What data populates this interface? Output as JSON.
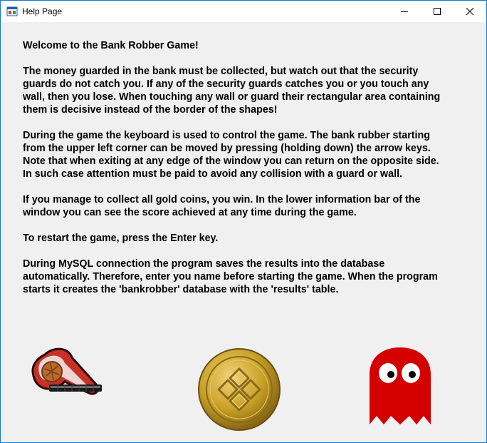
{
  "window": {
    "title": "Help Page",
    "icons": {
      "app": "window-app-icon",
      "minimize": "minimize-icon",
      "maximize": "maximize-icon",
      "close": "close-icon"
    }
  },
  "help": {
    "heading": "Welcome to the Bank Robber Game!",
    "p1": "The money guarded in the bank must be collected, but watch out that the security guards do not catch you. If any of the security guards catches you or you touch any  wall, then you lose. When touching any wall or guard their rectangular area containing them is decisive instead of the border of the shapes!",
    "p2": "During the game the keyboard is used to control the game. The bank rubber starting from the upper left corner can be moved by pressing (holding down) the arrow keys. Note that when exiting at any edge of the window you can return on the opposite side. In such case attention must be paid to avoid any collision with a guard or wall.",
    "p3": "If you manage to collect all gold coins, you win. In the lower information bar of the window you can see the score achieved at any time during the game.",
    "p4": "To restart the game, press the Enter key.",
    "p5": "During MySQL connection the program saves the results into the database automatically. Therefore, enter you name before starting the game. When the program starts it creates the 'bankrobber' database with the 'results' table."
  },
  "images": {
    "robber": "robber-sprite",
    "coin": "gold-coin",
    "guard": "red-ghost-guard"
  },
  "colors": {
    "window_border": "#1979ca",
    "background": "#f0f0f0",
    "guard_red": "#d40000",
    "coin_gold": "#c9a227"
  }
}
